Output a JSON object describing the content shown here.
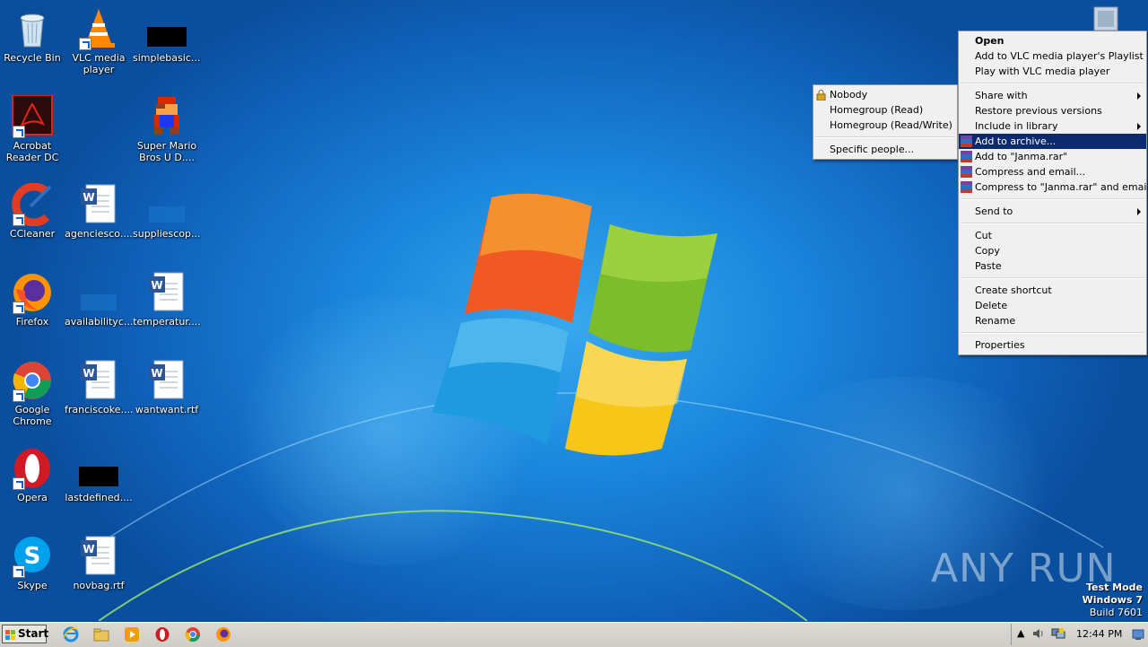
{
  "desktop_icons": [
    {
      "label": "Recycle Bin",
      "icon": "recycle-bin-icon"
    },
    {
      "label": "VLC media player",
      "icon": "vlc-icon"
    },
    {
      "label": "simplebasic....",
      "icon": "blank-file-icon"
    },
    {
      "label": "Acrobat Reader DC",
      "icon": "acrobat-icon"
    },
    {
      "label": "Super Mario Bros U D....",
      "icon": "mario-icon"
    },
    {
      "label": "CCleaner",
      "icon": "ccleaner-icon"
    },
    {
      "label": "agenciesco....",
      "icon": "word-doc-icon"
    },
    {
      "label": "suppliescop....",
      "icon": "blank-file-icon"
    },
    {
      "label": "Firefox",
      "icon": "firefox-icon"
    },
    {
      "label": "availabilityc....",
      "icon": "blank-file-icon"
    },
    {
      "label": "temperatur....",
      "icon": "word-doc-icon"
    },
    {
      "label": "Google Chrome",
      "icon": "chrome-icon"
    },
    {
      "label": "franciscoke....",
      "icon": "word-doc-icon"
    },
    {
      "label": "wantwant.rtf",
      "icon": "word-doc-icon"
    },
    {
      "label": "Opera",
      "icon": "opera-icon"
    },
    {
      "label": "lastdefined....",
      "icon": "blank-file-icon"
    },
    {
      "label": "Skype",
      "icon": "skype-icon"
    },
    {
      "label": "novbag.rtf",
      "icon": "word-doc-icon"
    }
  ],
  "share_submenu": {
    "items": [
      "Nobody",
      "Homegroup (Read)",
      "Homegroup (Read/Write)",
      "Specific people..."
    ]
  },
  "context_menu": {
    "open": "Open",
    "add_vlc_playlist": "Add to VLC media player's Playlist",
    "play_vlc": "Play with VLC media player",
    "share_with": "Share with",
    "restore_prev": "Restore previous versions",
    "include_library": "Include in library",
    "add_archive": "Add to archive...",
    "add_rar": "Add to \"Janma.rar\"",
    "compress_email": "Compress and email...",
    "compress_rar_email": "Compress to \"Janma.rar\" and email",
    "send_to": "Send to",
    "cut": "Cut",
    "copy": "Copy",
    "paste": "Paste",
    "create_shortcut": "Create shortcut",
    "delete": "Delete",
    "rename": "Rename",
    "properties": "Properties"
  },
  "watermark": {
    "brand": "ANY RUN",
    "test_mode": "Test Mode",
    "os": "Windows 7",
    "build": "Build 7601"
  },
  "taskbar": {
    "start_label": "Start",
    "pinned": [
      "ie-icon",
      "explorer-icon",
      "media-player-icon",
      "opera-icon",
      "chrome-icon",
      "firefox-icon"
    ],
    "clock": "12:44 PM"
  },
  "colors": {
    "highlight": "#0c2a6e",
    "desktop_blue": "#1a86dc"
  }
}
